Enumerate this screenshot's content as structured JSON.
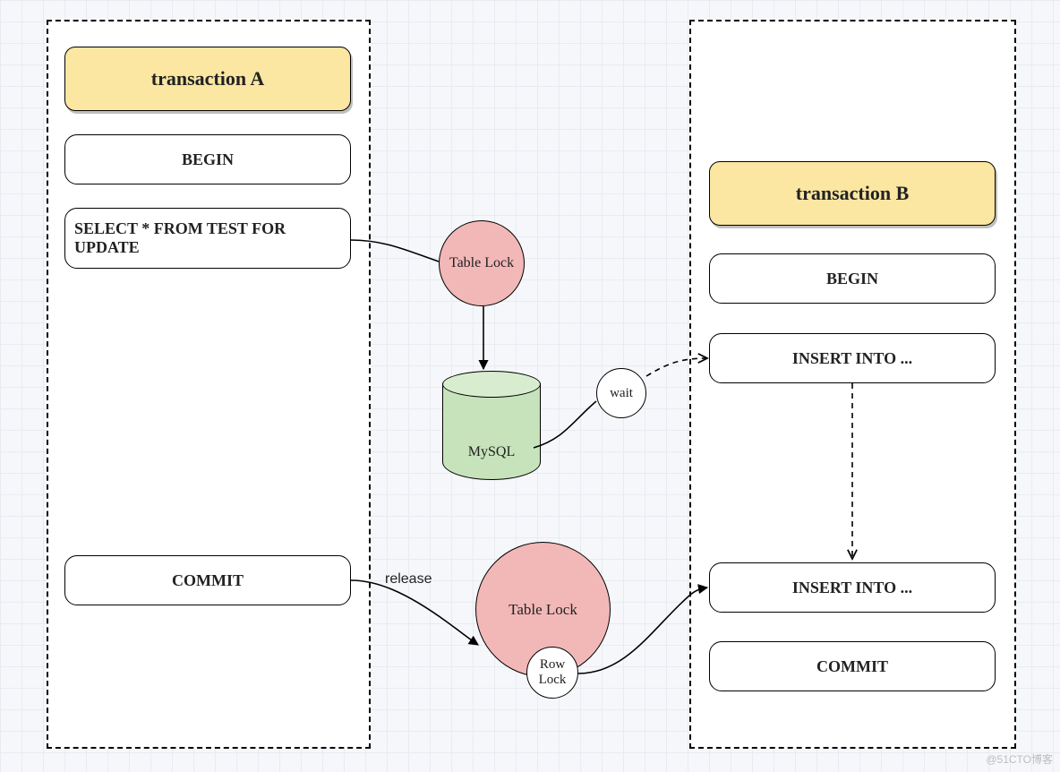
{
  "transactionA": {
    "title": "transaction A",
    "steps": [
      "BEGIN",
      "SELECT * FROM TEST FOR UPDATE",
      "COMMIT"
    ]
  },
  "transactionB": {
    "title": "transaction B",
    "steps": [
      "BEGIN",
      "INSERT INTO ...",
      "INSERT INTO ...",
      "COMMIT"
    ]
  },
  "locks": {
    "tableLock1": "Table Lock",
    "tableLock2": "Table Lock",
    "rowLock": "Row\nLock"
  },
  "db": {
    "label": "MySQL"
  },
  "edges": {
    "wait": "wait",
    "release": "release"
  },
  "watermark": "@51CTO博客"
}
